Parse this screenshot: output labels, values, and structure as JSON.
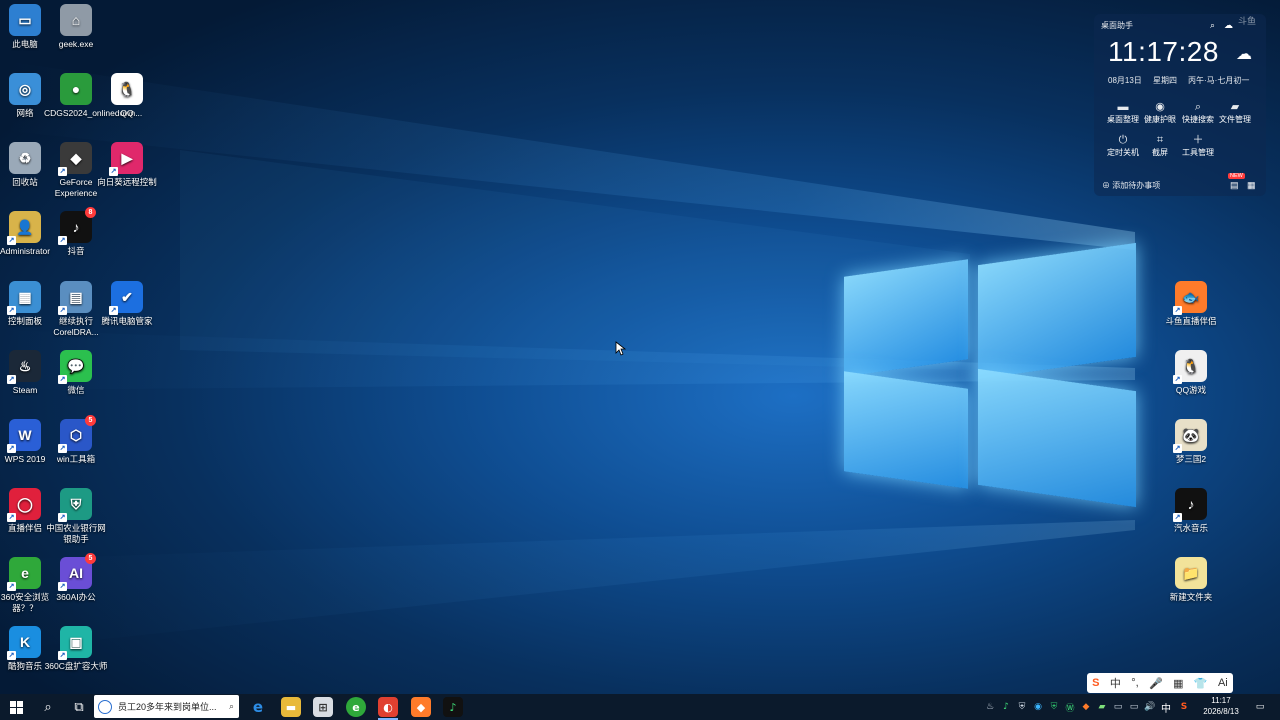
{
  "desktop_icons": [
    {
      "label": "此电脑",
      "name": "this-pc-icon",
      "color": "#2d7fd1",
      "glyph": "▭"
    },
    {
      "label": "geek.exe",
      "name": "geek-exe-icon",
      "color": "#8f9aa6",
      "glyph": "⌂"
    },
    {
      "label": "网络",
      "name": "network-icon",
      "color": "#3a8fd8",
      "glyph": "◎"
    },
    {
      "label": "CDGS2024_onlinedown...",
      "name": "coreldraw-installer-icon",
      "color": "#2a9b3c",
      "glyph": "●"
    },
    {
      "label": "QQ",
      "name": "qq-icon",
      "color": "#ffffff",
      "glyph": "🐧"
    },
    {
      "label": "回收站",
      "name": "recycle-bin-icon",
      "color": "#9aa9b8",
      "glyph": "♻"
    },
    {
      "label": "GeForce Experience",
      "name": "geforce-experience-icon",
      "color": "#3a3a3a",
      "glyph": "◆"
    },
    {
      "label": "向日葵远程控制",
      "name": "sunlogin-icon",
      "color": "#e0286b",
      "glyph": "▶"
    },
    {
      "label": "Administrator",
      "name": "user-folder-icon",
      "color": "#d8b34a",
      "glyph": "👤"
    },
    {
      "label": "抖音",
      "name": "douyin-icon",
      "color": "#111111",
      "glyph": "♪"
    },
    {
      "label": "控制面板",
      "name": "control-panel-icon",
      "color": "#3b8fd3",
      "glyph": "▦"
    },
    {
      "label": "继续执行CorelDRA...",
      "name": "coreldraw-resume-icon",
      "color": "#5a8ec0",
      "glyph": "▤"
    },
    {
      "label": "腾讯电脑管家",
      "name": "tencent-pc-manager-icon",
      "color": "#1c6fe0",
      "glyph": "✔"
    },
    {
      "label": "Steam",
      "name": "steam-icon",
      "color": "#1b2838",
      "glyph": "♨"
    },
    {
      "label": "微信",
      "name": "wechat-icon",
      "color": "#2bc04e",
      "glyph": "💬"
    },
    {
      "label": "WPS 2019",
      "name": "wps-icon",
      "color": "#2a5fd6",
      "glyph": "W"
    },
    {
      "label": "win工具箱",
      "name": "win-toolbox-icon",
      "color": "#2a57c8",
      "glyph": "⬡"
    },
    {
      "label": "直播伴侣",
      "name": "live-companion-icon",
      "color": "#e0203c",
      "glyph": "◯"
    },
    {
      "label": "中国农业银行网银助手",
      "name": "abc-bank-icon",
      "color": "#1d9a84",
      "glyph": "⛨"
    },
    {
      "label": "360安全浏览器？？",
      "name": "360-browser-icon",
      "color": "#2fa83a",
      "glyph": "e"
    },
    {
      "label": "360AI办公",
      "name": "360-ai-office-icon",
      "color": "#6a4ed6",
      "glyph": "AI"
    },
    {
      "label": "酷狗音乐",
      "name": "kugou-icon",
      "color": "#1a8ee0",
      "glyph": "K"
    },
    {
      "label": "360C盘扩容大师",
      "name": "360-c-drive-icon",
      "color": "#1fb5a6",
      "glyph": "▣"
    },
    {
      "label": "斗鱼直播伴侣",
      "name": "douyu-live-icon",
      "color": "#ff7b2a",
      "glyph": "🐟"
    },
    {
      "label": "QQ游戏",
      "name": "qq-game-icon",
      "color": "#f0f0f0",
      "glyph": "🐧"
    },
    {
      "label": "梦三国2",
      "name": "mengsanguo-icon",
      "color": "#e8e0c8",
      "glyph": "🐼"
    },
    {
      "label": "汽水音乐",
      "name": "soda-music-icon",
      "color": "#111111",
      "glyph": "♪"
    },
    {
      "label": "新建文件夹",
      "name": "new-folder-icon",
      "color": "#f2e39a",
      "glyph": "📁"
    }
  ],
  "widget": {
    "title": "桌面助手",
    "time": "11:17:28",
    "date": "08月13日",
    "weekday": "星期四",
    "lunar": "丙午·马·七月初一",
    "tools": [
      "桌面整理",
      "健康护眼",
      "快捷搜索",
      "文件管理",
      "定时关机",
      "截屏",
      "工具管理"
    ],
    "add_todo": "添加待办事项",
    "new_badge": "NEW"
  },
  "taskbar": {
    "search_text": "员工20多年来到岗单位...",
    "clock_time": "11:17",
    "clock_date": "2026/8/13",
    "ime_lang": "中",
    "tray_lang": "中"
  },
  "ime_toolbar": {
    "items": [
      "S",
      "中",
      "°,",
      "🎤",
      "▦",
      "👕",
      "Ai"
    ]
  }
}
